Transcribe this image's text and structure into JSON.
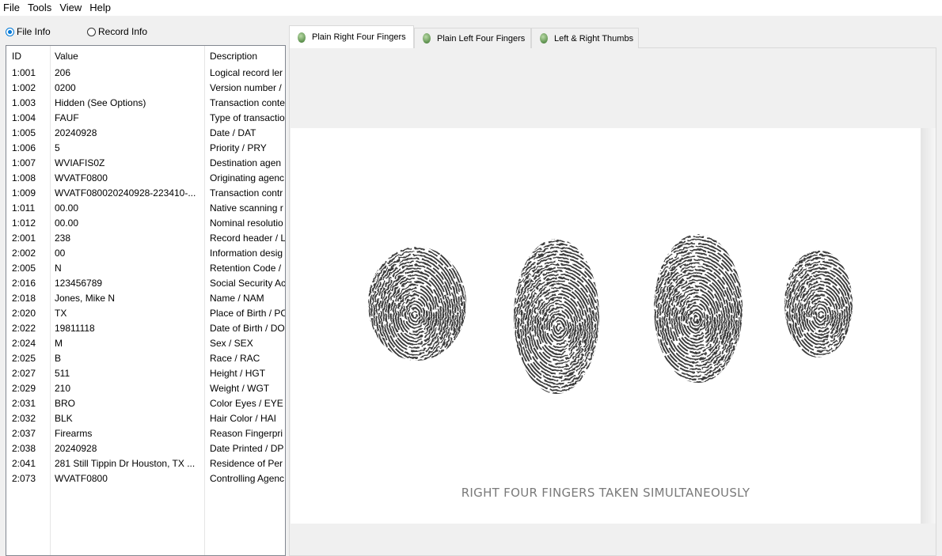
{
  "menu": [
    "File",
    "Tools",
    "View",
    "Help"
  ],
  "view_options": {
    "file_info": "File Info",
    "record_info": "Record Info"
  },
  "table": {
    "headers": {
      "id": "ID",
      "value": "Value",
      "description": "Description"
    },
    "rows": [
      {
        "id": "1:001",
        "value": "206",
        "description": "Logical record ler"
      },
      {
        "id": "1:002",
        "value": "0200",
        "description": "Version number /"
      },
      {
        "id": "1.003",
        "value": "Hidden (See Options)",
        "description": "Transaction conte"
      },
      {
        "id": "1:004",
        "value": "FAUF",
        "description": "Type of transactio"
      },
      {
        "id": "1:005",
        "value": "20240928",
        "description": "Date / DAT"
      },
      {
        "id": "1:006",
        "value": "5",
        "description": "Priority / PRY"
      },
      {
        "id": "1:007",
        "value": "WVIAFIS0Z",
        "description": "Destination agen"
      },
      {
        "id": "1:008",
        "value": "WVATF0800",
        "description": "Originating agenc"
      },
      {
        "id": "1:009",
        "value": "WVATF080020240928-223410-...",
        "description": "Transaction contr"
      },
      {
        "id": "1:011",
        "value": "00.00",
        "description": "Native scanning r"
      },
      {
        "id": "1:012",
        "value": "00.00",
        "description": "Nominal resolutio"
      },
      {
        "id": "2:001",
        "value": "238",
        "description": "Record header / L"
      },
      {
        "id": "2:002",
        "value": "00",
        "description": "Information desig"
      },
      {
        "id": "2:005",
        "value": "N",
        "description": "Retention Code /"
      },
      {
        "id": "2:016",
        "value": "123456789",
        "description": "Social Security Ac"
      },
      {
        "id": "2:018",
        "value": "Jones, Mike N",
        "description": "Name / NAM"
      },
      {
        "id": "2:020",
        "value": "TX",
        "description": "Place of Birth / PC"
      },
      {
        "id": "2:022",
        "value": "19811118",
        "description": "Date of Birth / DO"
      },
      {
        "id": "2:024",
        "value": "M",
        "description": "Sex / SEX"
      },
      {
        "id": "2:025",
        "value": "B",
        "description": "Race / RAC"
      },
      {
        "id": "2:027",
        "value": "511",
        "description": "Height / HGT"
      },
      {
        "id": "2:029",
        "value": "210",
        "description": "Weight / WGT"
      },
      {
        "id": "2:031",
        "value": "BRO",
        "description": "Color Eyes / EYE"
      },
      {
        "id": "2:032",
        "value": "BLK",
        "description": "Hair Color / HAI"
      },
      {
        "id": "2:037",
        "value": "Firearms",
        "description": "Reason Fingerpri"
      },
      {
        "id": "2:038",
        "value": "20240928",
        "description": "Date Printed / DP"
      },
      {
        "id": "2:041",
        "value": "281 Still Tippin Dr Houston, TX ...",
        "description": "Residence of Per"
      },
      {
        "id": "2:073",
        "value": "WVATF0800",
        "description": "Controlling Agenc"
      }
    ]
  },
  "tabs": [
    {
      "label": "Plain Right Four Fingers",
      "icon": "fingerprint-icon"
    },
    {
      "label": "Plain Left Four Fingers",
      "icon": "fingerprint-icon"
    },
    {
      "label": "Left & Right Thumbs",
      "icon": "fingerprint-icon"
    }
  ],
  "image": {
    "caption": "RIGHT FOUR FINGERS TAKEN SIMULTANEOUSLY"
  }
}
